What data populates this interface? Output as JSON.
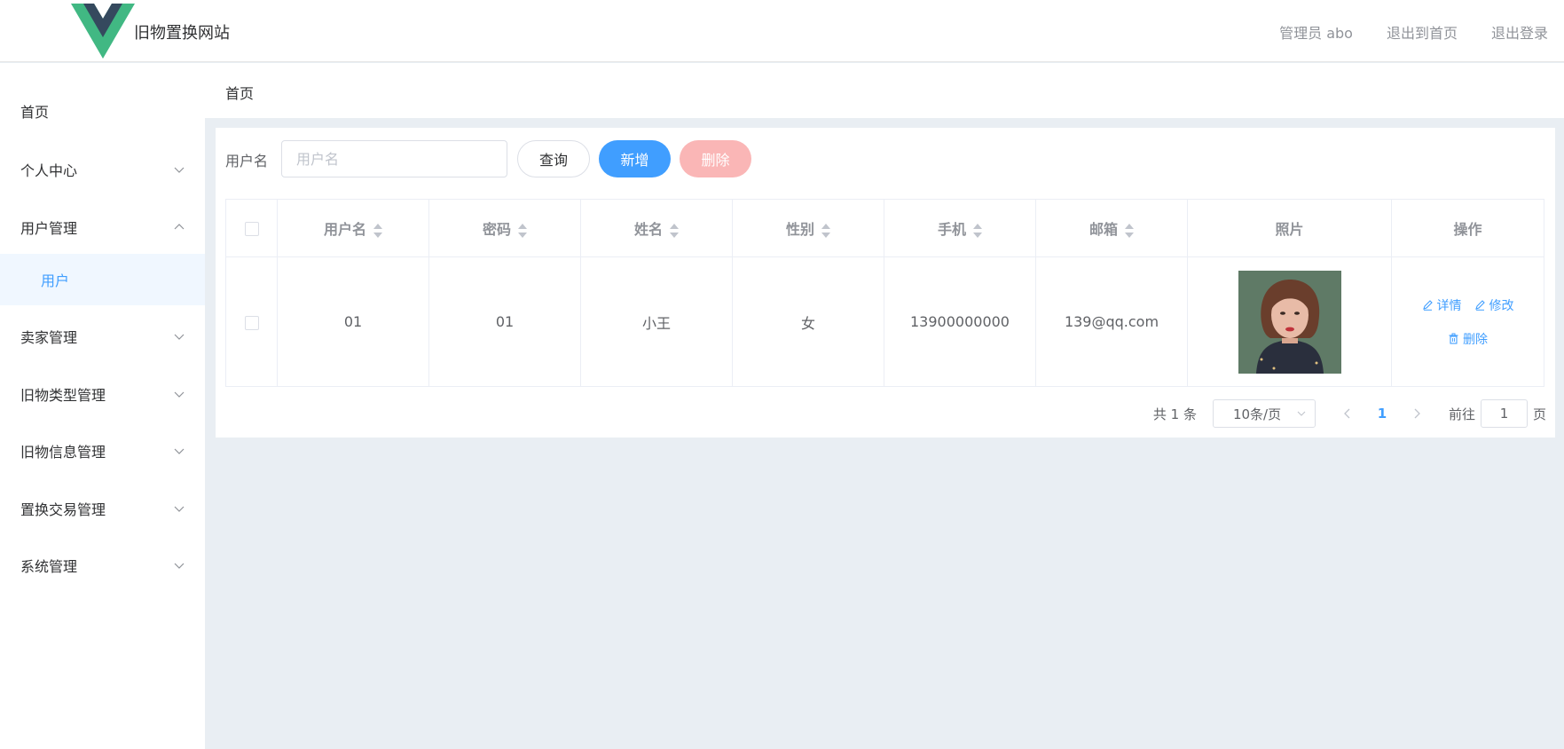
{
  "header": {
    "site_title": "旧物置换网站",
    "admin_label": "管理员 abo",
    "back_home_label": "退出到首页",
    "logout_label": "退出登录",
    "logo_colors": {
      "outer": "#41b883",
      "inner": "#35495e"
    }
  },
  "sidebar": {
    "items": [
      {
        "label": "首页",
        "has_chevron": false,
        "expanded": false
      },
      {
        "label": "个人中心",
        "has_chevron": true,
        "expanded": false
      },
      {
        "label": "用户管理",
        "has_chevron": true,
        "expanded": true
      },
      {
        "label": "卖家管理",
        "has_chevron": true,
        "expanded": false
      },
      {
        "label": "旧物类型管理",
        "has_chevron": true,
        "expanded": false
      },
      {
        "label": "旧物信息管理",
        "has_chevron": true,
        "expanded": false
      },
      {
        "label": "置换交易管理",
        "has_chevron": true,
        "expanded": false
      },
      {
        "label": "系统管理",
        "has_chevron": true,
        "expanded": false
      }
    ],
    "active_sub_item": "用户"
  },
  "breadcrumb": "首页",
  "search": {
    "label": "用户名",
    "placeholder": "用户名",
    "value": "",
    "query_button": "查询",
    "add_button": "新增",
    "delete_button": "删除"
  },
  "table": {
    "columns": [
      {
        "label": "用户名",
        "sortable": true
      },
      {
        "label": "密码",
        "sortable": true
      },
      {
        "label": "姓名",
        "sortable": true
      },
      {
        "label": "性别",
        "sortable": true
      },
      {
        "label": "手机",
        "sortable": true
      },
      {
        "label": "邮箱",
        "sortable": true
      },
      {
        "label": "照片",
        "sortable": false
      },
      {
        "label": "操作",
        "sortable": false
      }
    ],
    "rows": [
      {
        "username": "01",
        "password": "01",
        "name": "小王",
        "gender": "女",
        "phone": "13900000000",
        "email": "139@qq.com"
      }
    ],
    "actions": {
      "detail": "详情",
      "edit": "修改",
      "delete": "删除"
    }
  },
  "pagination": {
    "total": "共 1 条",
    "page_size": "10条/页",
    "current_page": "1",
    "goto_label": "前往",
    "goto_value": "1",
    "page_suffix": "页"
  },
  "colors": {
    "primary": "#409eff",
    "danger_disabled": "#fab6b6",
    "background": "#e9eef3"
  }
}
